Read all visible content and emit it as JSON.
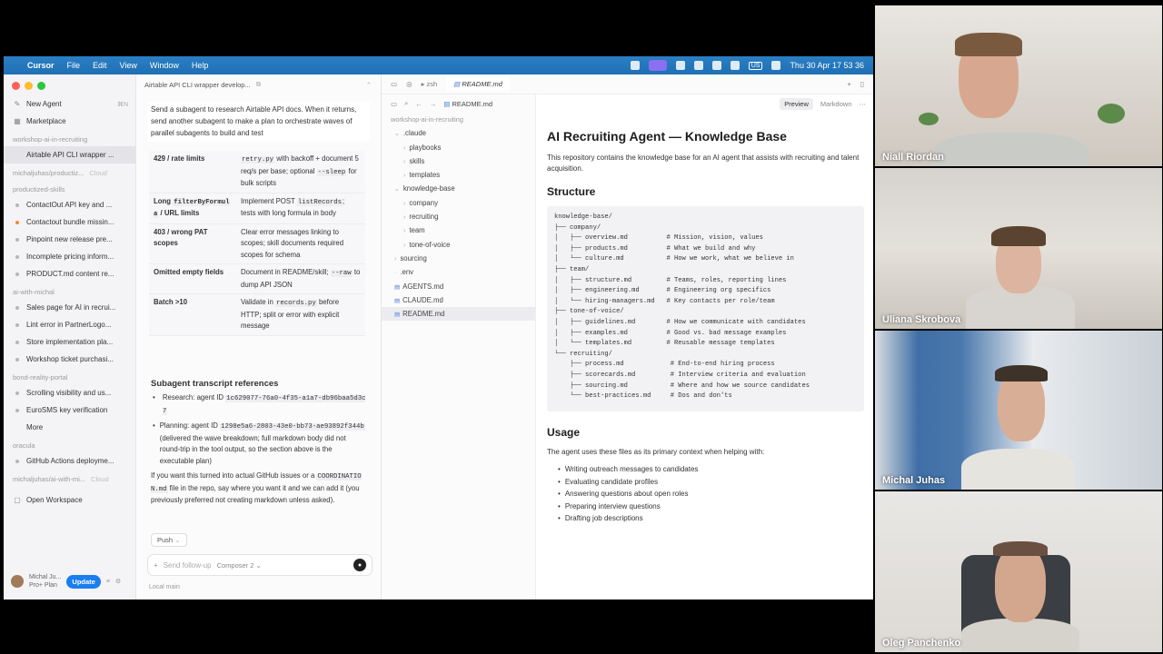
{
  "menubar": {
    "app": "Cursor",
    "menus": [
      "File",
      "Edit",
      "View",
      "Window",
      "Help"
    ],
    "clock": "Thu 30 Apr  17 53 36",
    "lang": "US"
  },
  "sidebar": {
    "new_agent": "New Agent",
    "new_agent_kbd": "⌘N",
    "marketplace": "Marketplace",
    "groups": [
      {
        "title": "workshop-ai-in-recruiting",
        "items": [
          {
            "label": "Airtable API CLI wrapper ...",
            "active": true,
            "dot": "none"
          }
        ]
      },
      {
        "title": "michaljuhas/productiz...",
        "suffix": "Cloud",
        "items": []
      },
      {
        "title": "productized-skills",
        "items": [
          {
            "label": "ContactOut API key and ...",
            "dot": "grey"
          },
          {
            "label": "Contactout bundle missin...",
            "dot": "orange"
          },
          {
            "label": "Pinpoint new release pre...",
            "dot": "grey"
          },
          {
            "label": "Incomplete pricing inform...",
            "dot": "grey"
          },
          {
            "label": "PRODUCT.md content re...",
            "dot": "grey"
          }
        ]
      },
      {
        "title": "ai-with-michal",
        "items": [
          {
            "label": "Sales page for AI in recrui...",
            "dot": "grey"
          },
          {
            "label": "Lint error in PartnerLogo...",
            "dot": "grey"
          },
          {
            "label": "Store implementation pla...",
            "dot": "grey"
          },
          {
            "label": "Workshop ticket purchasi...",
            "dot": "grey"
          }
        ]
      },
      {
        "title": "bond-reality-portal",
        "items": [
          {
            "label": "Scrolling visibility and us...",
            "dot": "grey"
          },
          {
            "label": "EuroSMS key verification",
            "dot": "grey"
          },
          {
            "label": "More",
            "dot": "none"
          }
        ]
      },
      {
        "title": "oracula",
        "items": [
          {
            "label": "GitHub Actions deployme...",
            "dot": "grey"
          }
        ]
      },
      {
        "title": "michaljuhas/ai-with-mi...",
        "suffix": "Cloud",
        "items": []
      }
    ],
    "open_workspace": "Open Workspace",
    "user": "Michal Ju...",
    "plan": "Pro+ Plan",
    "update": "Update"
  },
  "chat": {
    "title": "Airtable API CLI wrapper develop...",
    "user_message": "Send a subagent to research Airtable API docs. When it returns, send another subagent to make a plan to orchestrate waves of parallel subagents to build and test",
    "table": [
      {
        "issue": "429 / rate limits",
        "fix_parts": [
          [
            "code",
            "retry.py"
          ],
          [
            "text",
            " with backoff + document 5 req/s per base; optional "
          ],
          [
            "code",
            "--sleep"
          ],
          [
            "text",
            " for bulk scripts"
          ]
        ]
      },
      {
        "issue_parts": [
          [
            "text",
            "Long "
          ],
          [
            "code",
            "filterByFormula"
          ],
          [
            "text",
            " / URL limits"
          ]
        ],
        "fix_parts": [
          [
            "text",
            "Implement POST "
          ],
          [
            "code",
            "listRecords"
          ],
          [
            "text",
            "; tests with long formula in body"
          ]
        ]
      },
      {
        "issue": "403 / wrong PAT scopes",
        "fix_parts": [
          [
            "text",
            "Clear error messages linking to scopes; skill documents required scopes for schema"
          ]
        ]
      },
      {
        "issue": "Omitted empty fields",
        "fix_parts": [
          [
            "text",
            "Document in README/skill; "
          ],
          [
            "code",
            "--raw"
          ],
          [
            "text",
            " to dump API JSON"
          ]
        ]
      },
      {
        "issue": "Batch >10",
        "fix_parts": [
          [
            "text",
            "Validate in "
          ],
          [
            "code",
            "records.py"
          ],
          [
            "text",
            " before HTTP; split or error with explicit message"
          ]
        ]
      }
    ],
    "subagent_heading": "Subagent transcript references",
    "research_label": "Research: agent ID ",
    "research_id": "1c629077-76a0-4f35-a1a7-db96baa5d3c7",
    "planning_label": "Planning: agent ID ",
    "planning_id": "1298e5a6-2803-43e0-bb73-ae93892f344b",
    "planning_note": " (delivered the wave breakdown; full markdown body did not round-trip in the tool output, so the section above is the executable plan)",
    "tail_1": "If you want this turned into actual GitHub issues or a ",
    "tail_code": "COORDINATION.md",
    "tail_2": " file in the repo, say where you want it and we can add it (you previously preferred not creating markdown unless asked).",
    "push": "Push",
    "placeholder": "Send follow-up",
    "model": "Composer 2",
    "footer": "Local  main"
  },
  "editor": {
    "terminal_tab": "zsh",
    "file_tab": "README.md",
    "breadcrumb": "README.md",
    "preview_btn": "Preview",
    "markdown_btn": "Markdown"
  },
  "tree": {
    "root": "workshop-ai-in-recruiting",
    "rows": [
      {
        "label": ".claude",
        "depth": 1,
        "kind": "folder-open"
      },
      {
        "label": "playbooks",
        "depth": 2,
        "kind": "folder"
      },
      {
        "label": "skills",
        "depth": 2,
        "kind": "folder"
      },
      {
        "label": "templates",
        "depth": 2,
        "kind": "folder"
      },
      {
        "label": "knowledge-base",
        "depth": 1,
        "kind": "folder-open"
      },
      {
        "label": "company",
        "depth": 2,
        "kind": "folder"
      },
      {
        "label": "recruiting",
        "depth": 2,
        "kind": "folder"
      },
      {
        "label": "team",
        "depth": 2,
        "kind": "folder"
      },
      {
        "label": "tone-of-voice",
        "depth": 2,
        "kind": "folder"
      },
      {
        "label": "sourcing",
        "depth": 1,
        "kind": "folder"
      },
      {
        "label": ".env",
        "depth": 1,
        "kind": "file"
      },
      {
        "label": "AGENTS.md",
        "depth": 1,
        "kind": "md"
      },
      {
        "label": "CLAUDE.md",
        "depth": 1,
        "kind": "md"
      },
      {
        "label": "README.md",
        "depth": 1,
        "kind": "md",
        "selected": true
      }
    ]
  },
  "preview": {
    "h1": "AI Recruiting Agent — Knowledge Base",
    "intro": "This repository contains the knowledge base for an AI agent that assists with recruiting and talent acquisition.",
    "structure_h": "Structure",
    "code": "knowledge-base/\n├── company/\n│   ├── overview.md          # Mission, vision, values\n│   ├── products.md          # What we build and why\n│   └── culture.md           # How we work, what we believe in\n├── team/\n│   ├── structure.md         # Teams, roles, reporting lines\n│   ├── engineering.md       # Engineering org specifics\n│   └── hiring-managers.md   # Key contacts per role/team\n├── tone-of-voice/\n│   ├── guidelines.md        # How we communicate with candidates\n│   ├── examples.md          # Good vs. bad message examples\n│   └── templates.md         # Reusable message templates\n└── recruiting/\n    ├── process.md            # End-to-end hiring process\n    ├── scorecards.md         # Interview criteria and evaluation\n    ├── sourcing.md           # Where and how we source candidates\n    └── best-practices.md     # Dos and don'ts",
    "usage_h": "Usage",
    "usage_intro": "The agent uses these files as its primary context when helping with:",
    "usage_items": [
      "Writing outreach messages to candidates",
      "Evaluating candidate profiles",
      "Answering questions about open roles",
      "Preparing interview questions",
      "Drafting job descriptions"
    ]
  },
  "participants": [
    {
      "name": "Niall Riordan"
    },
    {
      "name": "Uliana Skrobova"
    },
    {
      "name": "Michal Juhas"
    },
    {
      "name": "Oleg Panchenko"
    }
  ]
}
